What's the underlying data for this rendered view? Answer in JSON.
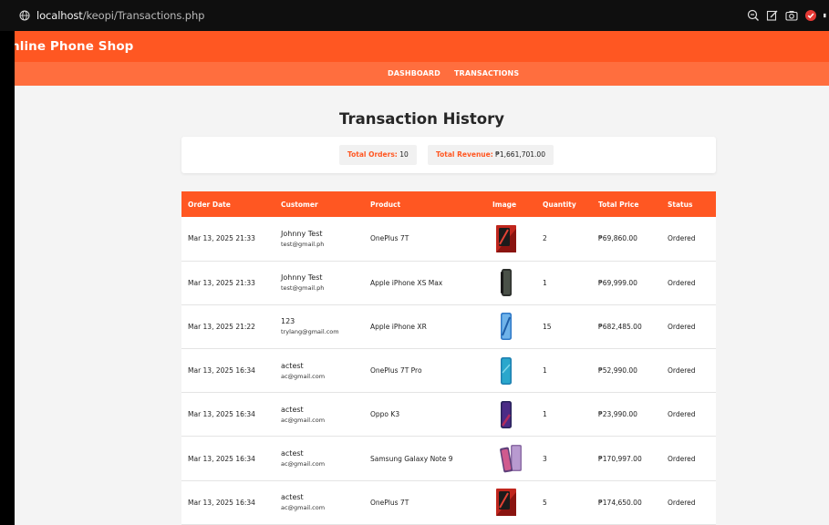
{
  "browser": {
    "url_host": "localhost",
    "url_path": "/keopi/Transactions.php"
  },
  "header": {
    "brand": "nline Phone Shop"
  },
  "nav": {
    "items": [
      {
        "label": "DASHBOARD"
      },
      {
        "label": "TRANSACTIONS"
      }
    ]
  },
  "page": {
    "title": "Transaction History"
  },
  "summary": {
    "orders_label": "Total Orders:",
    "orders_value": "10",
    "revenue_label": "Total Revenue:",
    "revenue_value": "₱1,661,701.00"
  },
  "table": {
    "headers": [
      "Order Date",
      "Customer",
      "Product",
      "Image",
      "Quantity",
      "Total Price",
      "Status"
    ],
    "rows": [
      {
        "date": "Mar 13, 2025 21:33",
        "name": "Johnny Test",
        "email": "test@gmail.ph",
        "product": "OnePlus 7T",
        "image": "red-phone",
        "qty": "2",
        "price": "₱69,860.00",
        "status": "Ordered"
      },
      {
        "date": "Mar 13, 2025 21:33",
        "name": "Johnny Test",
        "email": "test@gmail.ph",
        "product": "Apple iPhone XS Max",
        "image": "dark-phone",
        "qty": "1",
        "price": "₱69,999.00",
        "status": "Ordered"
      },
      {
        "date": "Mar 13, 2025 21:22",
        "name": "123",
        "email": "trylang@gmail.com",
        "product": "Apple iPhone XR",
        "image": "blue-phone",
        "qty": "15",
        "price": "₱682,485.00",
        "status": "Ordered"
      },
      {
        "date": "Mar 13, 2025 16:34",
        "name": "actest",
        "email": "ac@gmail.com",
        "product": "OnePlus 7T Pro",
        "image": "teal-phone",
        "qty": "1",
        "price": "₱52,990.00",
        "status": "Ordered"
      },
      {
        "date": "Mar 13, 2025 16:34",
        "name": "actest",
        "email": "ac@gmail.com",
        "product": "Oppo K3",
        "image": "purple-phone",
        "qty": "1",
        "price": "₱23,990.00",
        "status": "Ordered"
      },
      {
        "date": "Mar 13, 2025 16:34",
        "name": "actest",
        "email": "ac@gmail.com",
        "product": "Samsung Galaxy Note 9",
        "image": "lavender-phone",
        "qty": "3",
        "price": "₱170,997.00",
        "status": "Ordered"
      },
      {
        "date": "Mar 13, 2025 16:34",
        "name": "actest",
        "email": "ac@gmail.com",
        "product": "OnePlus 7T",
        "image": "red-phone",
        "qty": "5",
        "price": "₱174,650.00",
        "status": "Ordered"
      }
    ]
  },
  "colors": {
    "accent": "#ff5722",
    "nav_bg": "#ff6e3e",
    "page_bg": "#f4f4f4"
  }
}
